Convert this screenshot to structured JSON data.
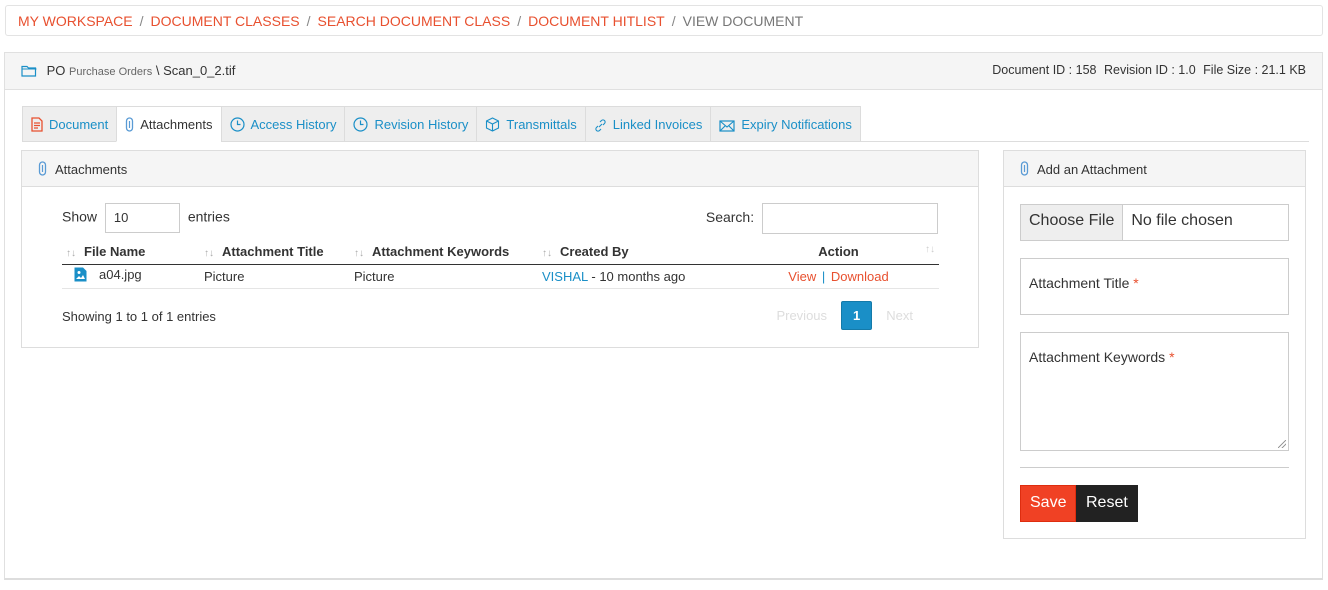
{
  "breadcrumb": {
    "items": [
      "MY WORKSPACE",
      "DOCUMENT CLASSES",
      "SEARCH DOCUMENT CLASS",
      "DOCUMENT HITLIST"
    ],
    "current": "VIEW DOCUMENT",
    "separator": "/"
  },
  "document": {
    "folder_icon": "folder-icon",
    "class_code": "PO",
    "class_name": "Purchase Orders",
    "path_sep": "\\",
    "file_name": "Scan_0_2.tif",
    "document_id": "Document ID : 158",
    "revision_id": "Revision ID : 1.0",
    "file_size": "File Size : 21.1 KB"
  },
  "tabs": [
    {
      "label": "Document",
      "icon": "file-pdf-icon",
      "active": false
    },
    {
      "label": "Attachments",
      "icon": "paperclip-icon",
      "active": true
    },
    {
      "label": "Access History",
      "icon": "clock-icon",
      "active": false
    },
    {
      "label": "Revision History",
      "icon": "clock-icon",
      "active": false
    },
    {
      "label": "Transmittals",
      "icon": "cube-icon",
      "active": false
    },
    {
      "label": "Linked Invoices",
      "icon": "link-icon",
      "active": false
    },
    {
      "label": "Expiry Notifications",
      "icon": "envelope-icon",
      "active": false
    }
  ],
  "attachments": {
    "title": "Attachments",
    "show_label": "Show",
    "page_length": "10",
    "entries_label": "entries",
    "search_label": "Search:",
    "search_value": "",
    "columns": [
      "File Name",
      "Attachment Title",
      "Attachment Keywords",
      "Created By",
      "Action"
    ],
    "rows": [
      {
        "file_icon": "image-file-icon",
        "file_name": "a04.jpg",
        "title": "Picture",
        "keywords": "Picture",
        "created_by_user": "VISHAL",
        "created_by_time": " - 10 months ago",
        "action_view": "View",
        "action_sep": "|",
        "action_download": "Download"
      }
    ],
    "info": "Showing 1 to 1 of 1 entries",
    "pagination": {
      "previous": "Previous",
      "current": "1",
      "next": "Next"
    }
  },
  "add_attachment": {
    "title": "Add an Attachment",
    "choose_file": "Choose File",
    "no_file": "No file chosen",
    "title_label": "Attachment Title",
    "keywords_label": "Attachment Keywords",
    "required_mark": "*",
    "save": "Save",
    "reset": "Reset"
  },
  "colors": {
    "accent_red": "#e8502f",
    "link_blue": "#1a8fc7",
    "save_button": "#f04124",
    "reset_button": "#222222"
  }
}
